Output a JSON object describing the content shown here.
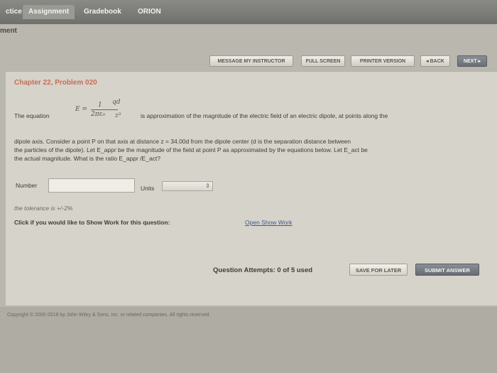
{
  "tabs": [
    {
      "label": "ctice"
    },
    {
      "label": "Assignment"
    },
    {
      "label": "Gradebook"
    },
    {
      "label": "ORION"
    }
  ],
  "breadcrumb": "ment",
  "nav": {
    "message": "MESSAGE MY INSTRUCTOR",
    "fullscreen": "FULL SCREEN",
    "printer": "PRINTER VERSION",
    "back": "◂ BACK",
    "next": "NEXT ▸"
  },
  "problem": {
    "title": "Chapter 22, Problem 020",
    "eq_prefix": "The equation",
    "eq_suffix": "is approximation of the magnitude of the electric field of an electric dipole, at points along the",
    "formula": {
      "lhs": "E =",
      "num1": "1",
      "num2": "qd",
      "den1": "2πε₀",
      "den2": "z³"
    },
    "line2": "dipole axis. Consider a point P on that axis at distance z = 34.00d from the dipole center (d is the separation distance between",
    "line3": "the particles of the dipole). Let E_appr be the magnitude of the field at point P as approximated by the equations below. Let E_act be",
    "line4": "the actual magnitude. What is the ratio E_appr /E_act?"
  },
  "answer": {
    "number_label": "Number",
    "number_value": "",
    "units_label": "Units"
  },
  "tolerance": "the tolerance is +/-2%",
  "show_work": {
    "prompt": "Click if you would like to Show Work for this question:",
    "link": "Open Show Work"
  },
  "attempts": "Question Attempts: 0 of 5 used",
  "save_label": "SAVE FOR LATER",
  "submit_label": "SUBMIT ANSWER",
  "copyright": "Copyright © 2000-2016 by John Wiley & Sons, Inc. or related companies. All rights reserved."
}
